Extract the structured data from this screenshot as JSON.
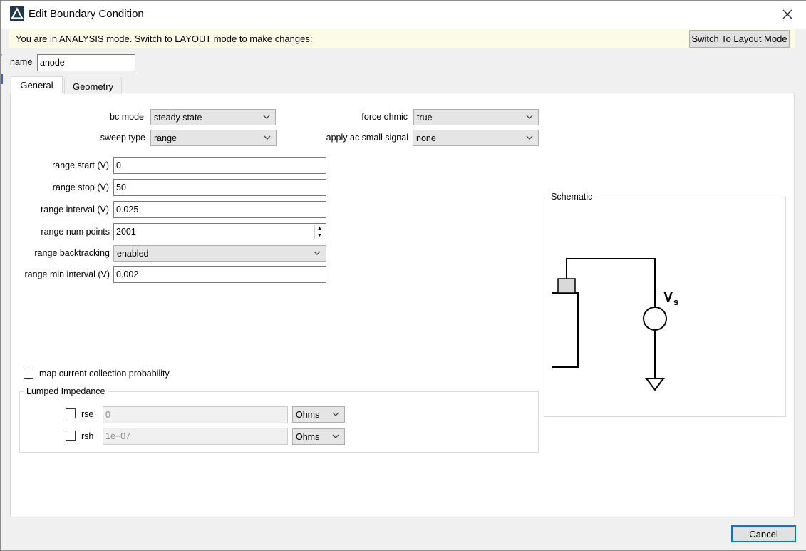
{
  "window": {
    "title": "Edit Boundary Condition",
    "close_icon": "close-icon"
  },
  "banner": {
    "text": "You are in ANALYSIS mode.  Switch to LAYOUT mode to make changes:",
    "switch_button": "Switch To Layout Mode",
    "background": "#fbfbe6"
  },
  "name_field": {
    "label": "name",
    "value": "anode"
  },
  "tabs": [
    {
      "label": "General",
      "active": true
    },
    {
      "label": "Geometry",
      "active": false
    }
  ],
  "general": {
    "bc_mode": {
      "label": "bc mode",
      "value": "steady state"
    },
    "sweep_type": {
      "label": "sweep type",
      "value": "range"
    },
    "force_ohmic": {
      "label": "force ohmic",
      "value": "true"
    },
    "apply_ac": {
      "label": "apply ac small signal",
      "value": "none"
    },
    "range_start": {
      "label": "range start (V)",
      "value": "0"
    },
    "range_stop": {
      "label": "range stop (V)",
      "value": "50"
    },
    "range_interval": {
      "label": "range interval (V)",
      "value": "0.025"
    },
    "range_num_points": {
      "label": "range num points",
      "value": "2001"
    },
    "range_backtracking": {
      "label": "range backtracking",
      "value": "enabled"
    },
    "range_min_interval": {
      "label": "range min interval (V)",
      "value": "0.002"
    },
    "map_current": {
      "label": "map current collection probability",
      "checked": false
    }
  },
  "lumped_impedance": {
    "title": "Lumped Impedance",
    "rse": {
      "label": "rse",
      "checked": false,
      "value": "0",
      "unit": "Ohms"
    },
    "rsh": {
      "label": "rsh",
      "checked": false,
      "value": "1e+07",
      "unit": "Ohms"
    }
  },
  "schematic": {
    "title": "Schematic",
    "source_label": "V",
    "source_subscript": "s"
  },
  "footer": {
    "cancel_button": "Cancel",
    "accent": "#0078d7"
  }
}
